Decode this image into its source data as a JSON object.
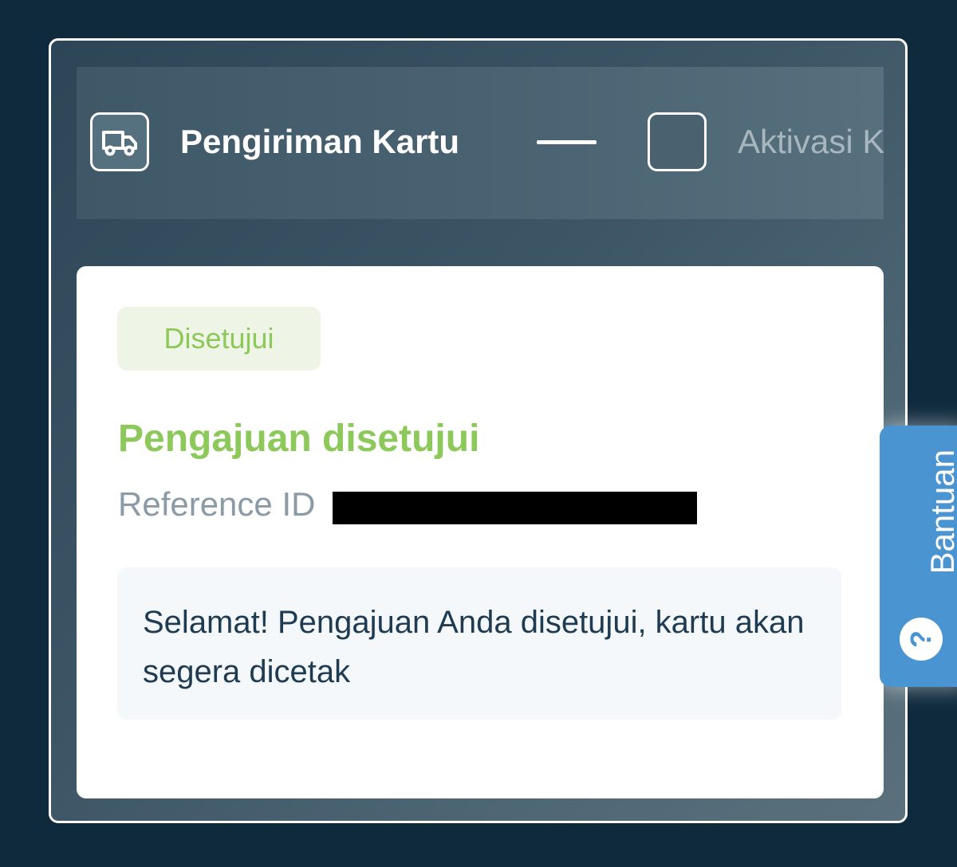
{
  "stepper": {
    "steps": [
      {
        "label": "Pengiriman Kartu",
        "icon": "truck-icon",
        "state": "active"
      },
      {
        "label": "Aktivasi Kartu",
        "icon": "empty-step-icon",
        "state": "inactive"
      }
    ]
  },
  "card": {
    "badge": "Disetujui",
    "title": "Pengajuan disetujui",
    "reference_label": "Reference ID",
    "message": "Selamat! Pengajuan Anda disetujui, kartu akan segera dicetak"
  },
  "help": {
    "label": "Bantuan",
    "icon": "question-icon"
  },
  "colors": {
    "background": "#0f2a3d",
    "success": "#8dc85a",
    "help_tab": "#4a94d1",
    "text_dark": "#1f3b52",
    "text_muted": "#8a9aa6"
  }
}
